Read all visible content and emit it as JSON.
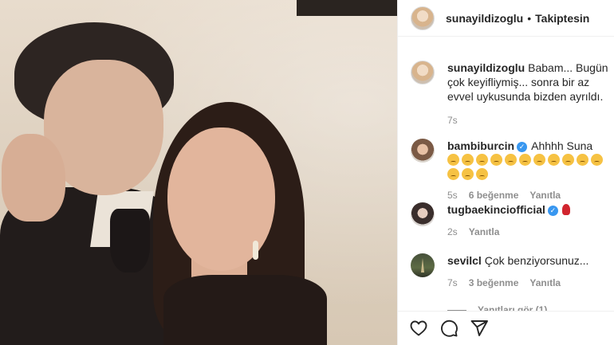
{
  "post": {
    "username": "sunayildizoglu",
    "separator": "•",
    "follow_status": "Takiptesin"
  },
  "caption": {
    "username": "sunayildizoglu",
    "text": "Babam... Bugün çok keyifliymiş... sonra bir az evvel uykusunda bizden ayrıldı.",
    "time": "7s"
  },
  "comments": [
    {
      "username": "bambiburcin",
      "verified": true,
      "text": "Ahhhh Suna",
      "emoji": "disappointed-face",
      "emoji_count": 14,
      "time": "5s",
      "likes": "6 beğenme",
      "reply": "Yanıtla"
    },
    {
      "username": "tugbaekincio fficial",
      "display_username": "tugbaekinciofficial",
      "verified": true,
      "emoji": "rose",
      "time": "2s",
      "reply": "Yanıtla"
    },
    {
      "username": "sevilcl",
      "text": "Çok benziyorsunuz...",
      "time": "7s",
      "likes": "3 beğenme",
      "reply": "Yanıtla"
    }
  ],
  "view_replies": "Yanıtları gör (1)",
  "icons": [
    "heart-icon",
    "comment-icon",
    "share-icon"
  ]
}
